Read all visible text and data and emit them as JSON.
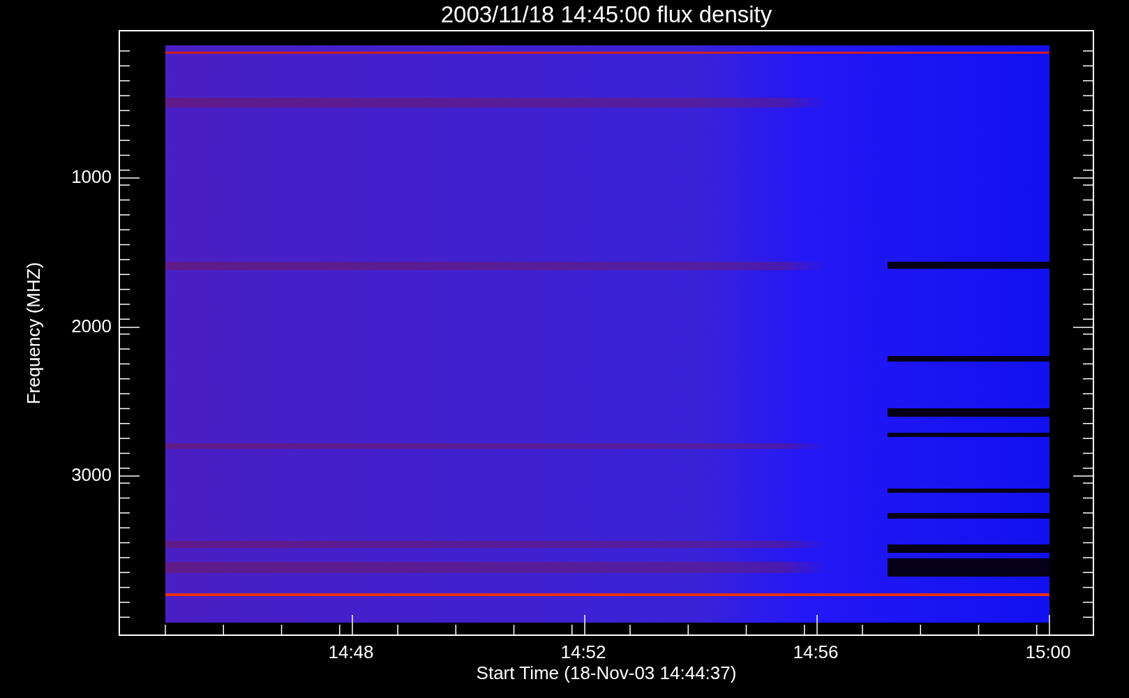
{
  "title": "2003/11/18 14:45:00 flux density",
  "y_axis": {
    "label": "Frequency (MHZ)",
    "ticks": [
      "1000",
      "2000",
      "3000"
    ]
  },
  "x_axis": {
    "label": "Start Time (18-Nov-03 14:44:37)",
    "ticks": [
      "14:48",
      "14:52",
      "14:56",
      "15:00"
    ]
  }
}
